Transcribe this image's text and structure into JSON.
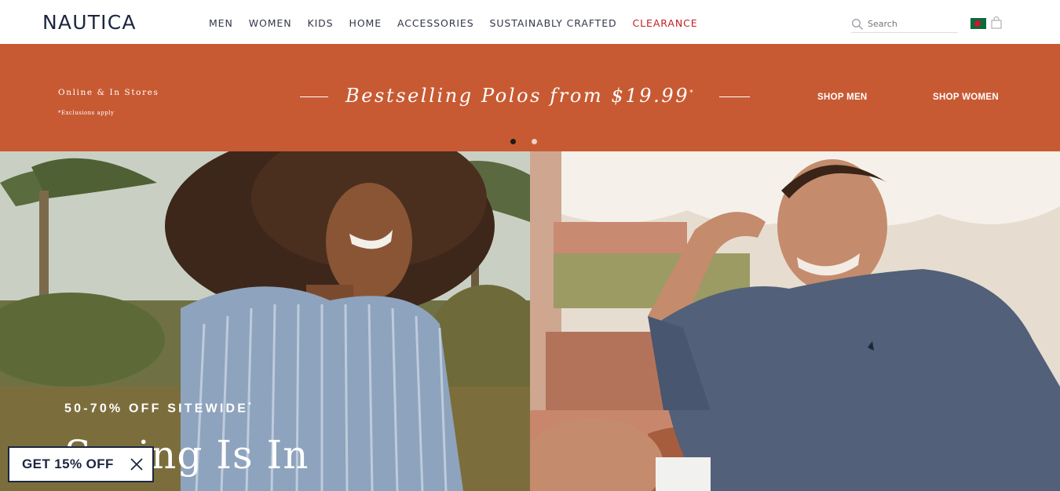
{
  "header": {
    "logo": "NAUTICA",
    "nav": [
      "MEN",
      "WOMEN",
      "KIDS",
      "HOME",
      "ACCESSORIES",
      "SUSTAINABLY CRAFTED",
      "CLEARANCE"
    ],
    "search_placeholder": "Search"
  },
  "promo": {
    "left_title": "Online & In Stores",
    "left_note": "*Exclusions apply",
    "headline": "Bestselling Polos from $19.99",
    "headline_mark": "*",
    "shop_men": "SHOP MEN",
    "shop_women": "SHOP WOMEN",
    "accent_color": "#c85a33"
  },
  "hero": {
    "kicker": "50-70% OFF SITEWIDE",
    "kicker_mark": "*",
    "title": "Spring Is In"
  },
  "popup": {
    "label": "GET 15% OFF"
  },
  "colors": {
    "navy": "#1c2640",
    "clearance": "#c21e22"
  }
}
